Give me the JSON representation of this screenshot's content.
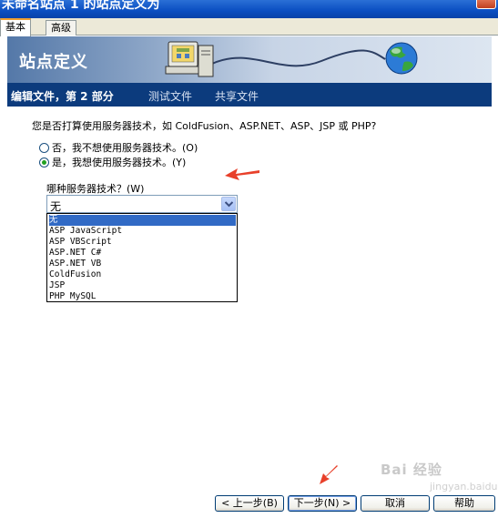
{
  "window": {
    "title": "未命名站点 1 的站点定义为"
  },
  "tabs": [
    {
      "label": "基本",
      "active": true
    },
    {
      "label": "高级",
      "active": false
    }
  ],
  "header": {
    "title": "站点定义"
  },
  "steps": {
    "current": "编辑文件，第 2 部分",
    "next": "测试文件",
    "last": "共享文件"
  },
  "question": "您是否打算使用服务器技术，如 ColdFusion、ASP.NET、ASP、JSP 或 PHP?",
  "radios": [
    {
      "label": "否，我不想使用服务器技术。(O)",
      "checked": false
    },
    {
      "label": "是，我想使用服务器技术。(Y)",
      "checked": true
    }
  ],
  "server_tech": {
    "label": "哪种服务器技术？(W)",
    "selected": "无",
    "options": [
      "无",
      "ASP JavaScript",
      "ASP VBScript",
      "ASP.NET C#",
      "ASP.NET VB",
      "ColdFusion",
      "JSP",
      "PHP MySQL"
    ]
  },
  "buttons": {
    "back": "< 上一步(B)",
    "next": "下一步(N) >",
    "cancel": "取消",
    "help": "帮助"
  },
  "watermark": {
    "brand": "Bai 经验",
    "url": "jingyan.baidu.com"
  },
  "colors": {
    "step_bar": "#0c3b7d",
    "selection": "#316ac5",
    "arrow": "#e8402a"
  }
}
